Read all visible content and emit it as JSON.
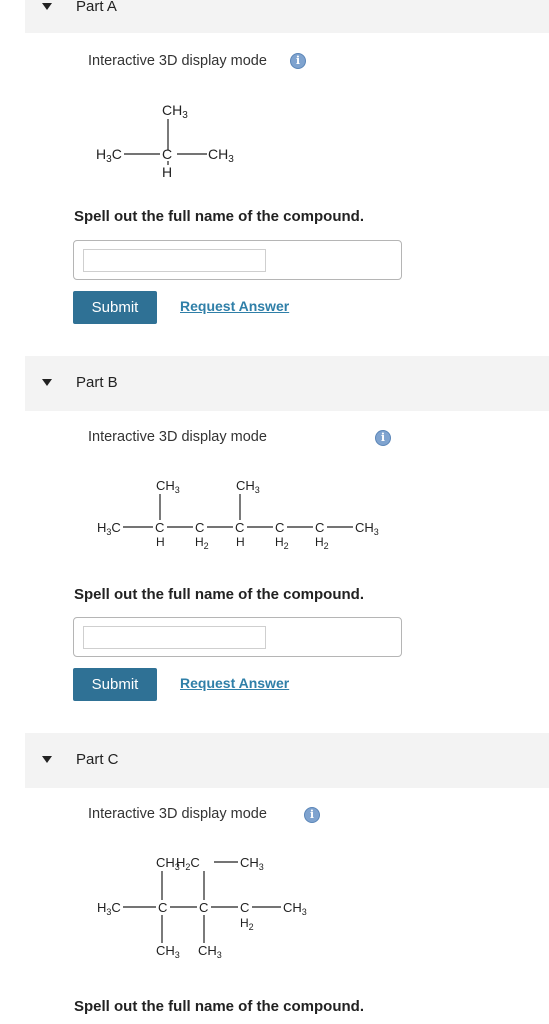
{
  "parts": [
    {
      "title": "Part A",
      "mode_label": "Interactive 3D display mode",
      "prompt": "Spell out the full name of the compound.",
      "answer_value": "",
      "submit_label": "Submit",
      "request_label": "Request Answer",
      "structure": {
        "ch3_top": "CH3",
        "left": "H3C",
        "center": "C",
        "right": "CH3",
        "h_below": "H"
      }
    },
    {
      "title": "Part B",
      "mode_label": "Interactive 3D display mode",
      "prompt": "Spell out the full name of the compound.",
      "answer_value": "",
      "submit_label": "Submit",
      "request_label": "Request Answer",
      "structure": {
        "left": "H3C",
        "carbons": [
          "C",
          "C",
          "C",
          "C",
          "C"
        ],
        "below": [
          "H",
          "H2",
          "H",
          "H2",
          "H2"
        ],
        "branch1": "CH3",
        "branch2": "CH3",
        "right": "CH3"
      }
    },
    {
      "title": "Part C",
      "mode_label": "Interactive 3D display mode",
      "prompt": "Spell out the full name of the compound.",
      "structure": {
        "top_left": "CH3",
        "top_mid": "H2C",
        "top_right": "CH3",
        "left": "H3C",
        "carbons": [
          "C",
          "C",
          "C"
        ],
        "c3_h": "H2",
        "right": "CH3",
        "bottom1": "CH3",
        "bottom2": "CH3"
      }
    }
  ],
  "icons": {
    "caret": "caret-down-icon",
    "info": "info-icon"
  },
  "colors": {
    "header_bg": "#f3f3f3",
    "submit_bg": "#2f7195",
    "link": "#2f7fa8",
    "info": "#7fa3cf"
  }
}
